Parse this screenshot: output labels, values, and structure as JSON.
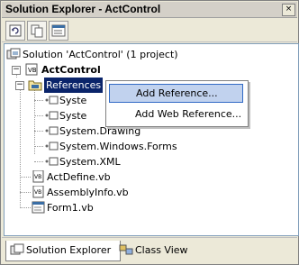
{
  "window": {
    "title": "Solution Explorer - ActControl",
    "close_glyph": "×"
  },
  "toolbar": {
    "buttons": [
      "refresh-icon",
      "copy-icon",
      "properties-icon"
    ]
  },
  "tree": {
    "solution": "Solution 'ActControl' (1 project)",
    "project": "ActControl",
    "references": "References",
    "ref_items": [
      "Syste",
      "Syste",
      "System.Drawing",
      "System.Windows.Forms",
      "System.XML"
    ],
    "files": [
      "ActDefine.vb",
      "AssemblyInfo.vb",
      "Form1.vb"
    ]
  },
  "context_menu": {
    "items": [
      "Add Reference...",
      "Add Web Reference..."
    ]
  },
  "tabs": [
    "Solution Explorer",
    "Class View"
  ]
}
